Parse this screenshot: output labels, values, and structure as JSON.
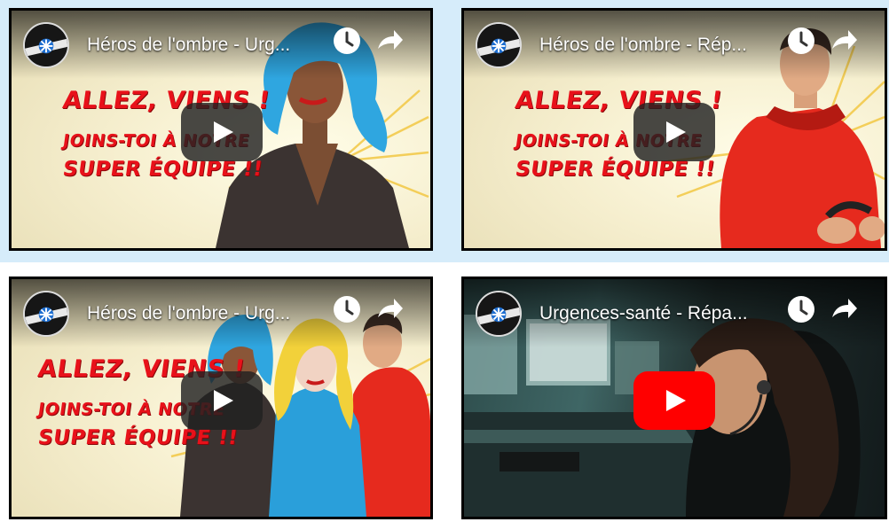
{
  "videos": [
    {
      "title": "Héros de l'ombre - Urg...",
      "slogan": [
        "ALLEZ, VIENS !",
        "JOINS-TOI À NOTRE",
        "SUPER ÉQUIPE !!"
      ],
      "play_style": "dark",
      "thumbnail": "animated-woman-blue-hair"
    },
    {
      "title": "Héros de l'ombre - Rép...",
      "slogan": [
        "ALLEZ, VIENS !",
        "JOINS-TOI À NOTRE",
        "SUPER ÉQUIPE !!"
      ],
      "play_style": "dark",
      "thumbnail": "animated-man-red-hoodie"
    },
    {
      "title": "Héros de l'ombre - Urg...",
      "slogan": [
        "ALLEZ, VIENS !",
        "JOINS-TOI À NOTRE",
        "SUPER ÉQUIPE !!"
      ],
      "play_style": "dark",
      "thumbnail": "animated-team-of-three"
    },
    {
      "title": "Urgences-santé - Répa...",
      "play_style": "red",
      "thumbnail": "photo-dispatcher-headset"
    }
  ],
  "icons": {
    "channel": "urgences-sante-logo-icon",
    "watch_later": "clock-icon",
    "share": "share-arrow-icon",
    "play": "play-icon"
  },
  "colors": {
    "page_bg": "#d6ecfa",
    "slogan_red": "#e8111a",
    "youtube_red": "#ff0000",
    "play_dark": "#212121"
  }
}
